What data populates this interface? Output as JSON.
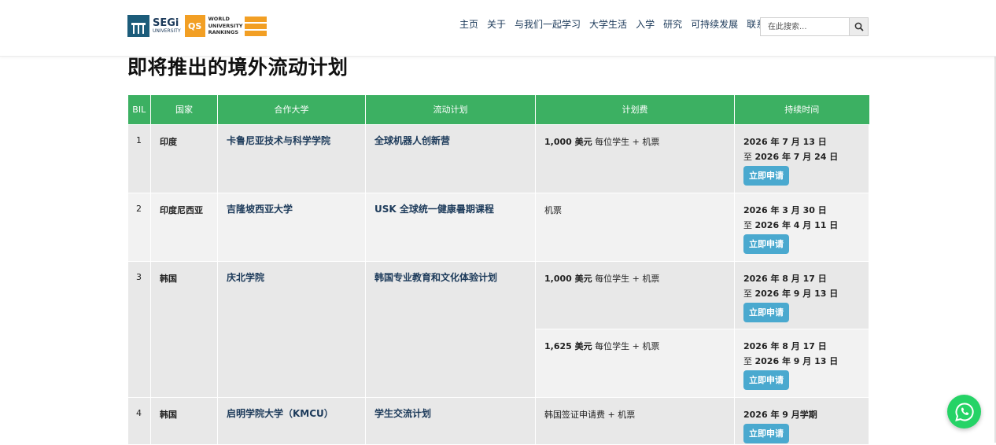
{
  "header": {
    "logo": {
      "segi_name": "SEGi",
      "segi_sub": "UNIVERSITY",
      "qs_badge": "QS",
      "qs_line1": "WORLD",
      "qs_line2": "UNIVERSITY",
      "qs_line3": "RANKINGS"
    },
    "nav": [
      "主页",
      "关于",
      "与我们一起学习",
      "大学生活",
      "入学",
      "研究",
      "可持续发展",
      "联系"
    ],
    "search": {
      "placeholder": "在此搜索..."
    }
  },
  "page": {
    "title": "即将推出的境外流动计划"
  },
  "table": {
    "headers": [
      "BIL",
      "国家",
      "合作大学",
      "流动计划",
      "计划费",
      "持续时间"
    ],
    "apply_label": "立即申请",
    "rows": [
      {
        "num": "1",
        "country": "印度",
        "university": "卡鲁尼亚技术与科学学院",
        "program": "全球机器人创新营",
        "fees": [
          {
            "amount": "1,000 美元",
            "note": " 每位学生 + 机票",
            "date_from": "2026 年 7 月 13 日",
            "to": "至 ",
            "date_to": "2026 年 7 月 24 日"
          }
        ]
      },
      {
        "num": "2",
        "country": "印度尼西亚",
        "university": "吉隆坡西亚大学",
        "program": "USK 全球统一健康暑期课程",
        "fees": [
          {
            "amount": "",
            "note": "机票",
            "date_from": "2026 年 3 月 30 日",
            "to": "至 ",
            "date_to": "2026 年 4 月 11 日"
          }
        ]
      },
      {
        "num": "3",
        "country": "韩国",
        "university": "庆北学院",
        "program": "韩国专业教育和文化体验计划",
        "fees": [
          {
            "amount": "1,000 美元",
            "note": " 每位学生 + 机票",
            "date_from": "2026 年 8 月 17 日",
            "to": "至 ",
            "date_to": "2026 年 9 月 13 日"
          },
          {
            "amount": "1,625 美元",
            "note": " 每位学生 + 机票",
            "date_from": "2026 年 8 月 17 日",
            "to": "至 ",
            "date_to": "2026 年 9 月 13 日"
          }
        ]
      },
      {
        "num": "4",
        "country": "韩国",
        "university": "启明学院大学（KMCU）",
        "program": "学生交流计划",
        "fees": [
          {
            "amount": "",
            "note": "韩国签证申请费 + 机票",
            "date_from": "2026 年 9 月学期",
            "to": "",
            "date_to": ""
          }
        ]
      }
    ]
  },
  "widgets": {
    "whatsapp_icon": "whatsapp-icon"
  },
  "colors": {
    "header_green": "#3cb062",
    "apply_blue": "#4aa9cf",
    "navy": "#1c3a5a",
    "whatsapp_green": "#25d366",
    "qs_orange": "#f29f24"
  }
}
